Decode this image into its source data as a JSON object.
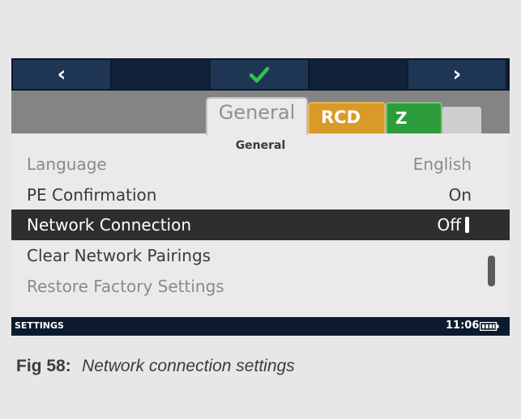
{
  "nav": {
    "back_icon": "chevron-left-icon",
    "confirm_icon": "checkmark-icon",
    "forward_icon": "chevron-right-icon",
    "confirm_color": "#33c24d"
  },
  "tabs": [
    {
      "label": "General",
      "color": "#ebe9ec",
      "active": true
    },
    {
      "label": "RCD",
      "color": "#d89b28",
      "active": false
    },
    {
      "label": "Z",
      "color": "#2d9c3c",
      "active": false
    },
    {
      "label": "",
      "color": "#cfcfd1",
      "active": false
    }
  ],
  "section_title": "General",
  "settings": [
    {
      "label": "Language",
      "value": "English",
      "state": "disabled"
    },
    {
      "label": "PE Confirmation",
      "value": "On",
      "state": "normal"
    },
    {
      "label": "Network Connection",
      "value": "Off",
      "state": "selected"
    },
    {
      "label": "Clear Network Pairings",
      "value": "",
      "state": "normal"
    },
    {
      "label": "Restore Factory Settings",
      "value": "",
      "state": "disabled"
    }
  ],
  "statusbar": {
    "mode": "SETTINGS",
    "time": "11:06",
    "battery_icon": "battery-icon"
  },
  "caption": {
    "figure": "Fig 58:",
    "text": "Network connection settings"
  }
}
